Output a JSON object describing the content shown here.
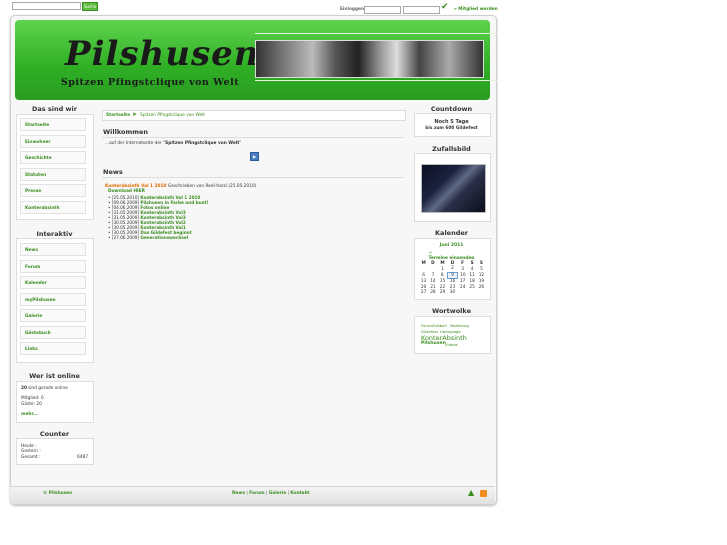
{
  "topbar": {
    "search_button": "Suche",
    "login_label": "Einloggen",
    "register_link": "» Mitglied werden"
  },
  "header": {
    "logo_text": "Pilshusen",
    "slogan": "Spitzen Pfingstclique von Welt"
  },
  "left": {
    "about_title": "Das sind wir",
    "about_items": [
      "Startseite",
      "Einwohner",
      "Geschichte",
      "Statuten",
      "Presse",
      "Konterabsinth"
    ],
    "interactive_title": "Interaktiv",
    "interactive_items": [
      "News",
      "Forum",
      "Kalender",
      "myPilshusen",
      "Galerie",
      "Gästebuch",
      "Links"
    ],
    "online_title": "Wer ist online",
    "online_count": "20",
    "online_text": "sind gerade online",
    "online_members": "Mitglied: 0",
    "online_guests": "Gäste: 20",
    "online_more": "mehr...",
    "counter_title": "Counter",
    "counter_today_label": "Heute :",
    "counter_yesterday_label": "Gestern :",
    "counter_total_label": "Gesamt :",
    "counter_total_value": "6487"
  },
  "main": {
    "breadcrumb_home": "Startseite",
    "breadcrumb_current": "Spitzen Pfingstclique von Welt",
    "welcome_title": "Willkommen",
    "welcome_text_prefix": "...auf der Internetseite der \"",
    "welcome_text_bold": "Spitzen Pfingstclique von Welt",
    "welcome_text_suffix": "\"",
    "news_title": "News",
    "news_headline": "Konterabsinth Vol 1 2010",
    "news_meta": "Geschrieben von Redi-harzi (25.05.2010)",
    "news_download": "Download HIER",
    "news_items": [
      {
        "date": "[25.05.2010]",
        "title": "Konterabsinth Vol 1 2010"
      },
      {
        "date": "[09.06.2009]",
        "title": "Pilshusen in Farbe und bunt!"
      },
      {
        "date": "[04.06.2009]",
        "title": "Fotos online"
      },
      {
        "date": "[31.05.2009]",
        "title": "Konterabsinth Vol3"
      },
      {
        "date": "[31.05.2009]",
        "title": "Konterabsinth Vol3"
      },
      {
        "date": "[30.05.2009]",
        "title": "Konterabsinth Vol2"
      },
      {
        "date": "[30.05.2009]",
        "title": "Konterabsinth Vol1"
      },
      {
        "date": "[30.05.2009]",
        "title": "Das Gildefest beginnt"
      },
      {
        "date": "[27.06.2009]",
        "title": "Generationswechsel"
      }
    ]
  },
  "right": {
    "countdown_title": "Countdown",
    "countdown_line1": "Noch 5 Tage",
    "countdown_line2": "bis zum 600 Gildefest",
    "random_image_title": "Zufallsbild",
    "calendar_title": "Kalender",
    "calendar_month": "Juni 2011",
    "calendar_prev": "«",
    "calendar_appointments": "Termine einsenden",
    "calendar_days": [
      "M",
      "D",
      "M",
      "D",
      "F",
      "S",
      "S"
    ],
    "calendar_weeks": [
      [
        "",
        "",
        "1",
        "2",
        "3",
        "4",
        "5"
      ],
      [
        "6",
        "7",
        "8",
        "9",
        "10",
        "11",
        "12"
      ],
      [
        "13",
        "14",
        "15",
        "16",
        "17",
        "18",
        "19"
      ],
      [
        "20",
        "21",
        "22",
        "23",
        "24",
        "25",
        "26"
      ],
      [
        "27",
        "28",
        "29",
        "30",
        "",
        "",
        ""
      ]
    ],
    "tagcloud_title": "Wortwolke",
    "tags": [
      "Forum",
      "Fußball",
      "Wolfsburg",
      "Gildefest",
      "Homepage",
      "KonterAbsinth",
      "Pilshusen",
      "Videos"
    ]
  },
  "footer": {
    "copyright": "© Pilshusen",
    "links": [
      "News",
      "Forum",
      "Galerie",
      "Kontakt"
    ],
    "separator": "|"
  },
  "colors": {
    "accent": "#3a8d1f",
    "header_green": "#3dbf30",
    "news_orange": "#e06a00"
  }
}
